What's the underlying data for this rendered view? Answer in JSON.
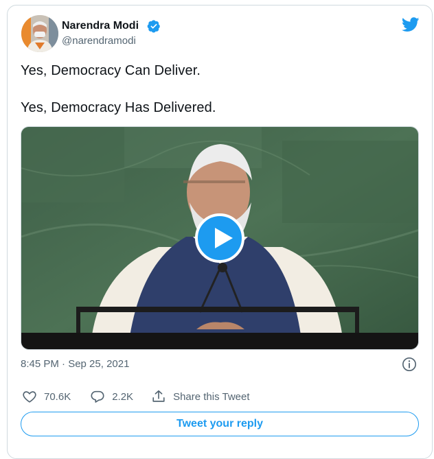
{
  "author": {
    "name": "Narendra Modi",
    "handle": "@narendramodi",
    "verified": true
  },
  "tweet": {
    "lines": [
      "Yes, Democracy Can Deliver.",
      "Yes, Democracy Has Delivered."
    ],
    "timestamp": "8:45 PM · Sep 25, 2021"
  },
  "media": {
    "type": "video",
    "play_icon": "play-icon"
  },
  "actions": {
    "likes": "70.6K",
    "replies": "2.2K",
    "share_label": "Share this Tweet"
  },
  "reply_prompt": "Tweet your reply",
  "colors": {
    "accent": "#1d9bf0",
    "text": "#0f1419",
    "muted": "#536471",
    "border": "#cfd9de"
  }
}
